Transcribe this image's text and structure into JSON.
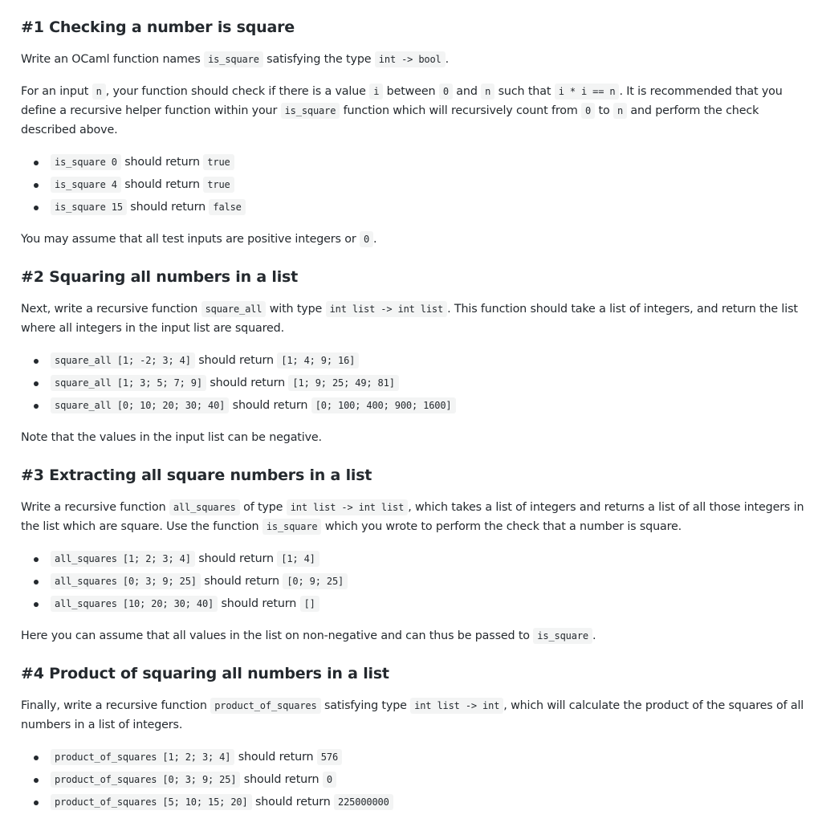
{
  "sections": [
    {
      "title": "#1 Checking a number is square",
      "intro": {
        "t1": "Write an OCaml function names ",
        "c1": "is_square",
        "t2": " satisfying the type ",
        "c2": "int -> bool",
        "t3": "."
      },
      "para2": {
        "t1": "For an input ",
        "c1": "n",
        "t2": ", your function should check if there is a value ",
        "c2": "i",
        "t3": " between ",
        "c3": "0",
        "t4": " and ",
        "c4": "n",
        "t5": " such that ",
        "c5": "i * i == n",
        "t6": ". It is recommended that you define a recursive helper function within your ",
        "c6": "is_square",
        "t7": " function which will recursively count from ",
        "c7": "0",
        "t8": " to ",
        "c8": "n",
        "t9": " and perform the check described above."
      },
      "examples": [
        {
          "call": "is_square 0",
          "mid": " should return ",
          "result": "true"
        },
        {
          "call": "is_square 4",
          "mid": " should return ",
          "result": "true"
        },
        {
          "call": "is_square 15",
          "mid": " should return ",
          "result": "false"
        }
      ],
      "note": {
        "t1": "You may assume that all test inputs are positive integers or ",
        "c1": "0",
        "t2": "."
      }
    },
    {
      "title": "#2 Squaring all numbers in a list",
      "intro": {
        "t1": "Next, write a recursive function ",
        "c1": "square_all",
        "t2": " with type ",
        "c2": "int list -> int list",
        "t3": ". This function should take a list of integers, and return the list where all integers in the input list are squared."
      },
      "examples": [
        {
          "call": "square_all [1; -2; 3; 4]",
          "mid": " should return ",
          "result": "[1; 4; 9; 16]"
        },
        {
          "call": "square_all [1; 3; 5; 7; 9]",
          "mid": " should return ",
          "result": "[1; 9; 25; 49; 81]"
        },
        {
          "call": "square_all [0; 10; 20; 30; 40]",
          "mid": " should return ",
          "result": "[0; 100; 400; 900; 1600]"
        }
      ],
      "note": {
        "t1": "Note that the values in the input list can be negative."
      }
    },
    {
      "title": "#3 Extracting all square numbers in a list",
      "intro": {
        "t1": "Write a recursive function ",
        "c1": "all_squares",
        "t2": " of type ",
        "c2": "int list -> int list",
        "t3": ", which takes a list of integers and returns a list of all those integers in the list which are square. Use the function ",
        "c3": "is_square",
        "t4": " which you wrote to perform the check that a number is square."
      },
      "examples": [
        {
          "call": "all_squares [1; 2; 3; 4]",
          "mid": " should return ",
          "result": "[1; 4]"
        },
        {
          "call": "all_squares [0; 3; 9; 25]",
          "mid": " should return ",
          "result": "[0; 9; 25]"
        },
        {
          "call": "all_squares [10; 20; 30; 40]",
          "mid": " should return ",
          "result": "[]"
        }
      ],
      "note": {
        "t1": "Here you can assume that all values in the list on non-negative and can thus be passed to ",
        "c1": "is_square",
        "t2": "."
      }
    },
    {
      "title": "#4 Product of squaring all numbers in a list",
      "intro": {
        "t1": "Finally, write a recursive function ",
        "c1": "product_of_squares",
        "t2": " satisfying type ",
        "c2": "int list -> int",
        "t3": ", which will calculate the product of the squares of all numbers in a list of integers."
      },
      "examples": [
        {
          "call": "product_of_squares [1; 2; 3; 4]",
          "mid": " should return ",
          "result": "576"
        },
        {
          "call": "product_of_squares [0; 3; 9; 25]",
          "mid": " should return ",
          "result": "0"
        },
        {
          "call": "product_of_squares [5; 10; 15; 20]",
          "mid": " should return ",
          "result": "225000000"
        }
      ]
    }
  ]
}
